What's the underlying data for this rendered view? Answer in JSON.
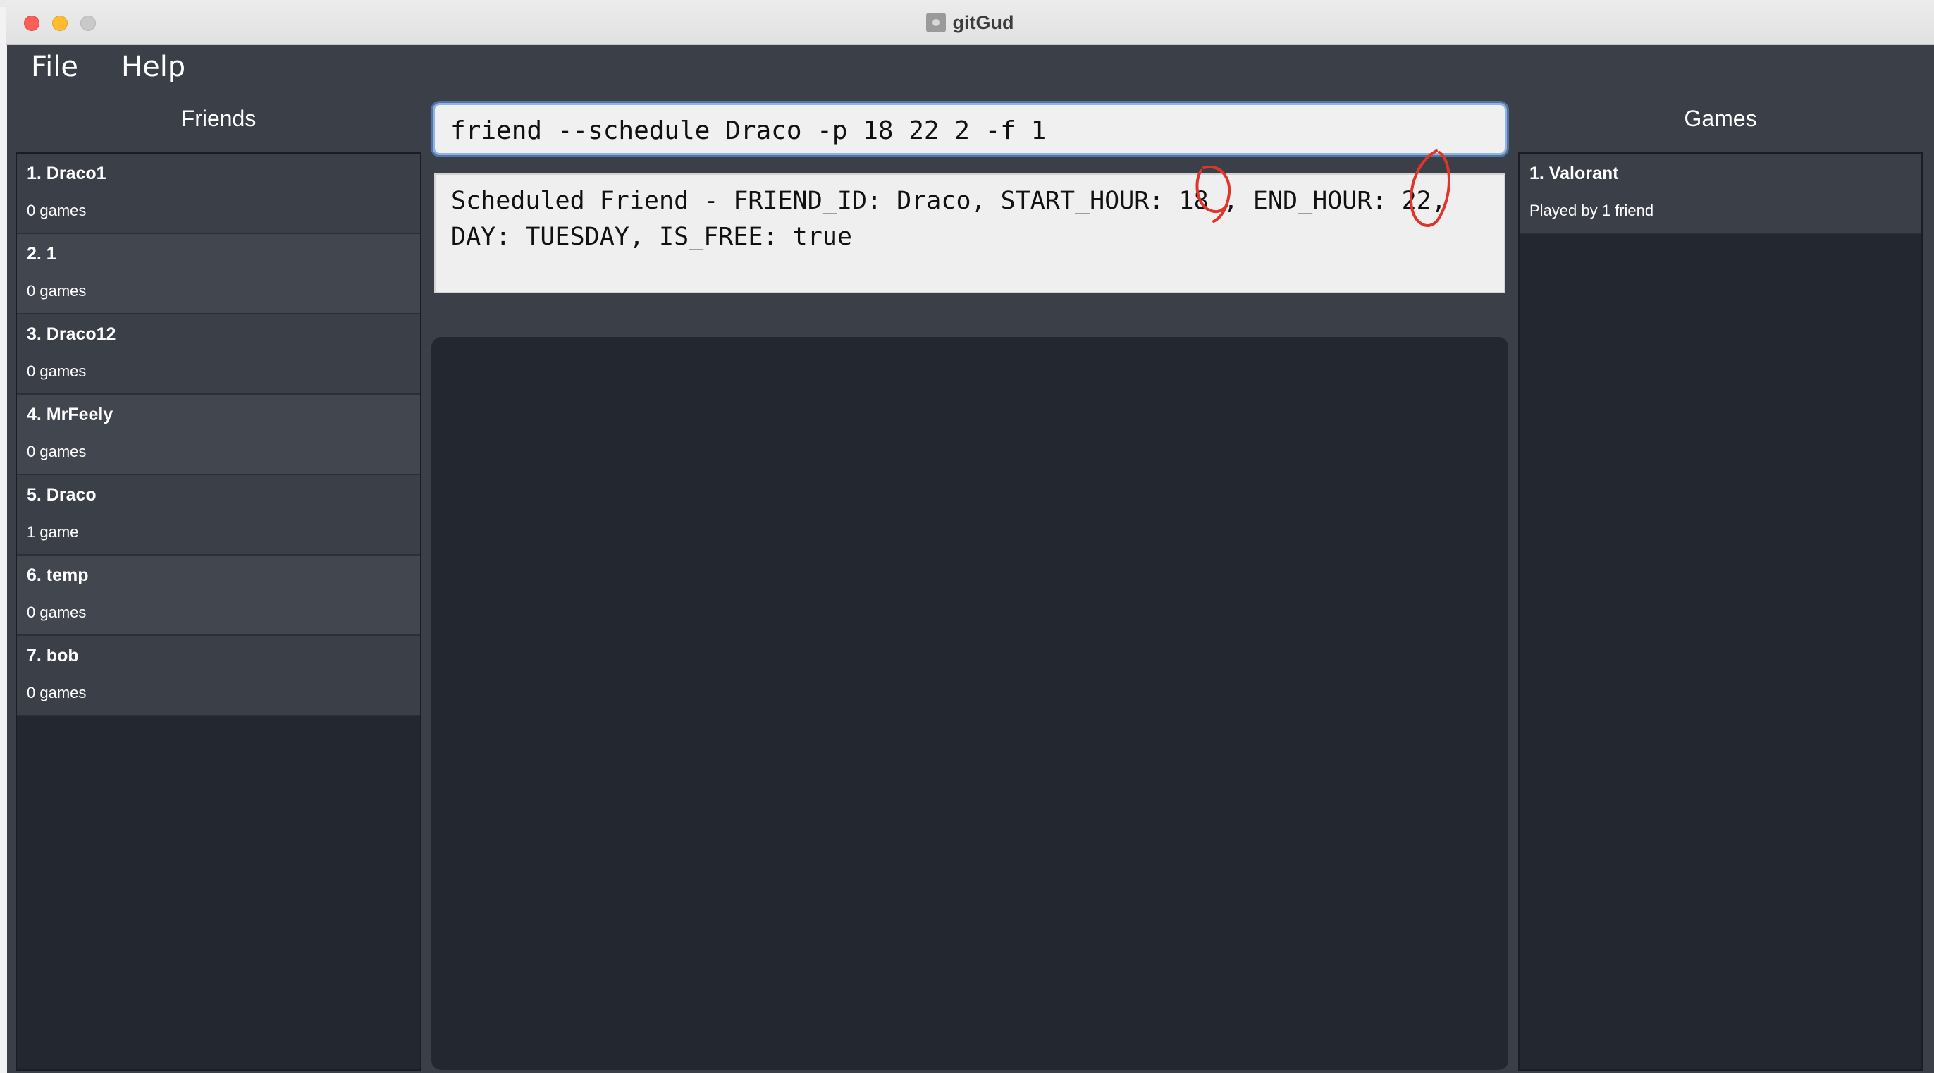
{
  "window": {
    "title": "gitGud"
  },
  "menu": {
    "file": "File",
    "help": "Help"
  },
  "friends": {
    "header": "Friends",
    "items": [
      {
        "name": "1. Draco1",
        "sub": "0 games"
      },
      {
        "name": "2. 1",
        "sub": "0 games"
      },
      {
        "name": "3. Draco12",
        "sub": "0 games"
      },
      {
        "name": "4. MrFeely",
        "sub": "0 games"
      },
      {
        "name": "5. Draco",
        "sub": "1 game"
      },
      {
        "name": "6. temp",
        "sub": "0 games"
      },
      {
        "name": "7. bob",
        "sub": "0 games"
      }
    ]
  },
  "command": {
    "value": "friend --schedule Draco -p 18 22 2 -f 1"
  },
  "result": {
    "text": "Scheduled Friend - FRIEND_ID: Draco, START_HOUR: 18 , END_HOUR: 22, DAY: TUESDAY, IS_FREE: true"
  },
  "games": {
    "header": "Games",
    "items": [
      {
        "name": "1. Valorant",
        "sub": "Played by 1 friend"
      }
    ]
  },
  "colors": {
    "background": "#3a3f48",
    "list_panel": "#232730",
    "list_item": "#3b3f47",
    "annotation": "#e0352b"
  }
}
